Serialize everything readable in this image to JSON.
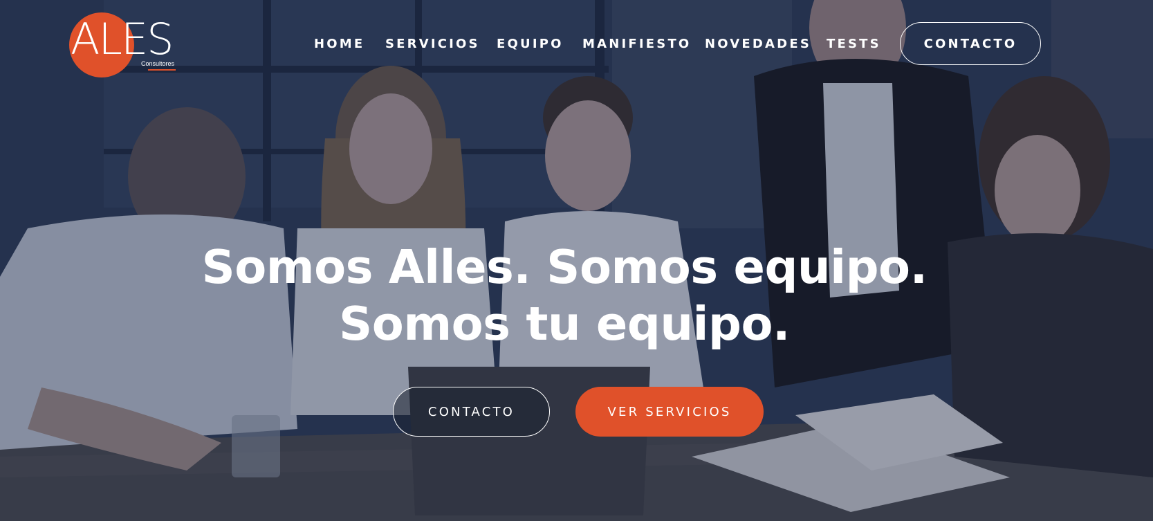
{
  "brand": {
    "logo_text": "ALES",
    "logo_subtitle": "Consultores",
    "accent_color": "#e0512a"
  },
  "nav": {
    "items": [
      {
        "label": "HOME"
      },
      {
        "label": "SERVICIOS"
      },
      {
        "label": "EQUIPO"
      },
      {
        "label": "MANIFIESTO"
      },
      {
        "label": "NOVEDADES"
      },
      {
        "label": "TESTS"
      }
    ],
    "contact_label": "CONTACTO"
  },
  "hero": {
    "headline_line1": "Somos Alles. Somos equipo.",
    "headline_line2": "Somos tu equipo.",
    "primary_cta": "CONTACTO",
    "secondary_cta": "VER SERVICIOS",
    "background_image": "team-meeting-photo"
  }
}
